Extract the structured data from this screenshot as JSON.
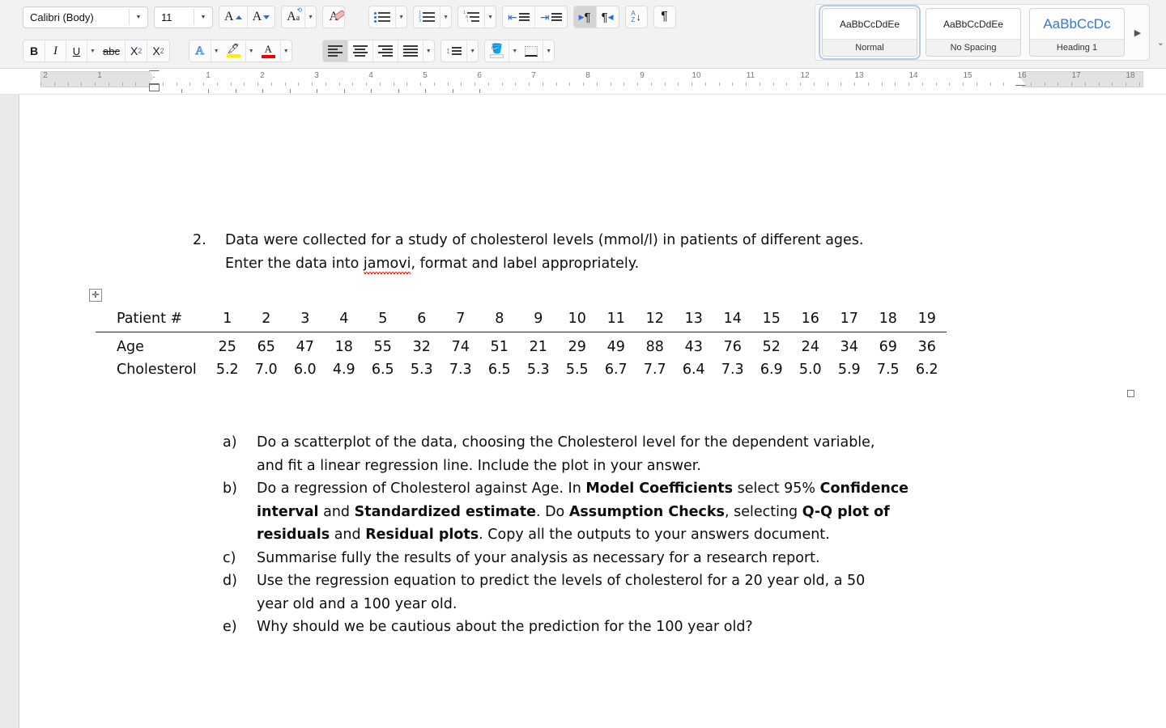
{
  "ribbon": {
    "font_name": {
      "value": "Calibri (Body)",
      "name": "font-name-combo"
    },
    "font_size": {
      "value": "11"
    },
    "buttons_row1": [
      {
        "name": "grow-font-button",
        "label": "A"
      },
      {
        "name": "shrink-font-button",
        "label": "A"
      },
      {
        "name": "change-case-button",
        "label": "Aa"
      },
      {
        "name": "clear-formatting-button",
        "label": "A"
      }
    ],
    "buttons_row2": [
      {
        "name": "bold-button",
        "label": "B"
      },
      {
        "name": "italic-button",
        "label": "I"
      },
      {
        "name": "underline-button",
        "label": "U"
      },
      {
        "name": "strikethrough-button",
        "label": "abc"
      },
      {
        "name": "subscript-button",
        "label": "X"
      },
      {
        "name": "superscript-button",
        "label": "X"
      },
      {
        "name": "text-effects-button",
        "label": "A"
      },
      {
        "name": "highlight-color-button",
        "label": ""
      },
      {
        "name": "font-color-button",
        "label": "A"
      }
    ],
    "paragraph": {
      "bullets": "bullet-list-button",
      "numbering": "numbered-list-button",
      "multilevel": "multilevel-list-button",
      "decrease_indent": "decrease-indent-button",
      "increase_indent": "increase-indent-button",
      "ltr": "left-to-right-button",
      "rtl": "right-to-left-button",
      "sort": "sort-button",
      "show_marks": "show-formatting-marks-button",
      "align_left": "align-left-button",
      "align_center": "align-center-button",
      "align_right": "align-right-button",
      "justify": "justify-button",
      "line_spacing": "line-spacing-button",
      "shading": "shading-button",
      "borders": "borders-button"
    },
    "colors": {
      "accent_blue": "#2a6fd6",
      "highlight_yellow": "#ffee00",
      "font_color_red": "#f40000",
      "heading_blue": "#3a78c8",
      "selected_gray": "#d4d4d4"
    },
    "styles": {
      "gallery": [
        {
          "preview": "AaBbCcDdEe",
          "name": "Normal",
          "active": true
        },
        {
          "preview": "AaBbCcDdEe",
          "name": "No Spacing",
          "active": false
        },
        {
          "preview": "AaBbCcDc",
          "name": "Heading 1",
          "active": false
        }
      ],
      "more_label": "▶"
    }
  },
  "ruler": {
    "left_numbers": [
      "2",
      "1"
    ],
    "numbers": [
      "1",
      "2",
      "3",
      "4",
      "5",
      "6",
      "7",
      "8",
      "9",
      "10",
      "11",
      "12",
      "13",
      "14",
      "15",
      "16",
      "17",
      "18"
    ],
    "first_line_indent_pos": "0",
    "right_indent_pos": "16"
  },
  "document": {
    "question": {
      "number": "2.",
      "line1": "Data were collected for a study of cholesterol levels (mmol/l) in patients of different ages.",
      "line2_pre": "Enter the data into ",
      "line2_misspelled": "jamovi",
      "line2_post": ", format and label appropriately."
    },
    "table": {
      "row_labels": [
        "Patient #",
        "Age",
        "Cholesterol"
      ],
      "patient_numbers": [
        "1",
        "2",
        "3",
        "4",
        "5",
        "6",
        "7",
        "8",
        "9",
        "10",
        "11",
        "12",
        "13",
        "14",
        "15",
        "16",
        "17",
        "18",
        "19"
      ],
      "age": [
        "25",
        "65",
        "47",
        "18",
        "55",
        "32",
        "74",
        "51",
        "21",
        "29",
        "49",
        "88",
        "43",
        "76",
        "52",
        "24",
        "34",
        "69",
        "36"
      ],
      "cholesterol": [
        "5.2",
        "7.0",
        "6.0",
        "4.9",
        "6.5",
        "5.3",
        "7.3",
        "6.5",
        "5.3",
        "5.5",
        "6.7",
        "7.7",
        "6.4",
        "7.3",
        "6.9",
        "5.0",
        "5.9",
        "7.5",
        "6.2"
      ]
    },
    "sub_questions": [
      {
        "label": "a)",
        "lines": [
          [
            {
              "t": "Do a scatterplot of the data, choosing the Cholesterol level for the dependent variable,",
              "b": false
            }
          ],
          [
            {
              "t": "and fit a linear regression line. Include the plot in your answer.",
              "b": false
            }
          ]
        ]
      },
      {
        "label": "b)",
        "lines": [
          [
            {
              "t": "Do a regression of Cholesterol against Age. In ",
              "b": false
            },
            {
              "t": "Model Coefficients",
              "b": true
            },
            {
              "t": " select 95% ",
              "b": false
            },
            {
              "t": "Confidence",
              "b": true
            }
          ],
          [
            {
              "t": "interval",
              "b": true
            },
            {
              "t": " and ",
              "b": false
            },
            {
              "t": "Standardized estimate",
              "b": true
            },
            {
              "t": ". Do ",
              "b": false
            },
            {
              "t": "Assumption Checks",
              "b": true
            },
            {
              "t": ", selecting ",
              "b": false
            },
            {
              "t": "Q-Q plot of",
              "b": true
            }
          ],
          [
            {
              "t": "residuals",
              "b": true
            },
            {
              "t": " and ",
              "b": false
            },
            {
              "t": "Residual plots",
              "b": true
            },
            {
              "t": ". Copy all the outputs to your answers document.",
              "b": false
            }
          ]
        ]
      },
      {
        "label": "c)",
        "lines": [
          [
            {
              "t": "Summarise fully the results of your analysis as necessary for a research report.",
              "b": false
            }
          ]
        ]
      },
      {
        "label": "d)",
        "lines": [
          [
            {
              "t": "Use the regression equation to predict the levels of cholesterol for a 20 year old, a 50",
              "b": false
            }
          ],
          [
            {
              "t": "year old and a 100 year old.",
              "b": false
            }
          ]
        ]
      },
      {
        "label": "e)",
        "lines": [
          [
            {
              "t": "Why should we be cautious about the prediction for the 100 year old?",
              "b": false
            }
          ]
        ]
      }
    ]
  }
}
